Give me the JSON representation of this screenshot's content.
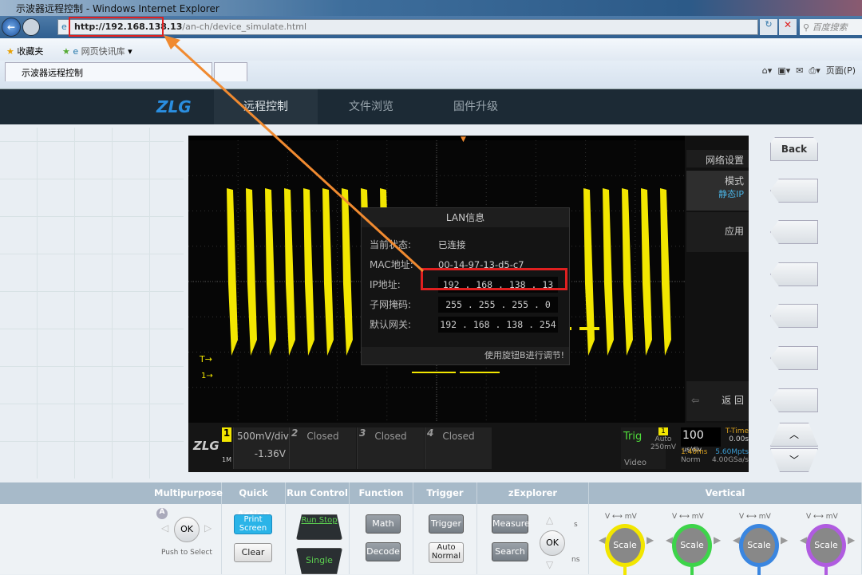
{
  "browser": {
    "window_title": "示波器远程控制 - Windows Internet Explorer",
    "url_host": "http://192.168.138.13",
    "url_path": "/an-ch/device_simulate.html",
    "search_placeholder": "百度搜索",
    "favorites_label": "收藏夹",
    "quicklinks_label": "网页快讯库",
    "tab_title": "示波器远程控制",
    "page_menu": "页面(P)"
  },
  "site_nav": {
    "tabs": [
      {
        "label": "远程控制",
        "active": true
      },
      {
        "label": "文件浏览"
      },
      {
        "label": "固件升级"
      }
    ]
  },
  "lan_dialog": {
    "title": "LAN信息",
    "rows": [
      {
        "label": "当前状态:",
        "value": "已连接"
      },
      {
        "label": "MAC地址:",
        "value": "00-14-97-13-d5-c7"
      },
      {
        "label": "IP地址:",
        "value": "192 . 168 . 138 . 13"
      },
      {
        "label": "子网掩码:",
        "value": "255 . 255 . 255 .  0"
      },
      {
        "label": "默认网关:",
        "value": "192 . 168 . 138 . 254"
      }
    ],
    "footer": "使用旋钮B进行调节!"
  },
  "side_menu": {
    "title": "网络设置",
    "mode_label": "模式",
    "mode_value": "静态IP",
    "apply": "应用",
    "back": "返 回"
  },
  "status": {
    "ch1_num": "1",
    "ch1_scale": "500mV/div",
    "ch1_offset": "-1.36V",
    "ch1_imp": "1M",
    "ch2_num": "2",
    "ch2": "Closed",
    "ch3_num": "3",
    "ch3": "Closed",
    "ch4_num": "4",
    "ch4": "Closed",
    "trig": "Trig",
    "trig_src": "1",
    "trig_mode": "Auto",
    "trig_type": "Video",
    "trig_level": "250mV",
    "timebase": "100",
    "timebase_unit": "us/div",
    "ttime_label": "T-Time",
    "ttime": "0.00s",
    "delay": "1.40ms",
    "mpts": "5.60Mpts",
    "acq": "Norm",
    "rate": "4.00GSa/s",
    "marker_t": "T",
    "marker_1": "1"
  },
  "soft_buttons": {
    "back": "Back"
  },
  "panel": {
    "sections": [
      "Multipurpose",
      "Quick Action",
      "Run Control",
      "Function",
      "Trigger",
      "zExplorer",
      "Vertical"
    ],
    "ok": "OK",
    "push_to_select": "Push to Select",
    "marker_a": "A",
    "print_screen": "Print Screen",
    "clear": "Clear",
    "run_stop": "Run Stop",
    "single": "Single",
    "math": "Math",
    "decode": "Decode",
    "trigger": "Trigger",
    "auto_normal": "Auto Normal",
    "measure": "Measure",
    "search": "Search",
    "s": "s",
    "ns": "ns",
    "v_label": "V",
    "mv_label": "mV",
    "scale": "Scale"
  },
  "colors": {
    "ch1": "#f2e600",
    "ch2": "#3dd44a",
    "ch3": "#3a86e0",
    "ch4": "#b05ce0",
    "highlight": "#e02020",
    "arrow": "#f08a30"
  }
}
